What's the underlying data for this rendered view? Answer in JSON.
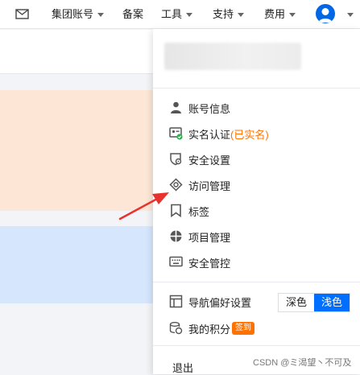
{
  "nav": {
    "group_account": "集团账号",
    "beian": "备案",
    "tools": "工具",
    "support": "支持",
    "billing": "费用"
  },
  "menu": {
    "account_info": "账号信息",
    "realname": "实名认证",
    "realname_status": "(已实名)",
    "security_settings": "安全设置",
    "access_management": "访问管理",
    "tags": "标签",
    "project_management": "项目管理",
    "security_control": "安全管控",
    "nav_preference": "导航偏好设置",
    "theme_dark": "深色",
    "theme_light": "浅色",
    "my_points": "我的积分",
    "sign_in_badge": "签到",
    "logout": "退出"
  },
  "colors": {
    "accent": "#006eff",
    "warning": "#ff7200",
    "annotation": "#e8322e"
  },
  "watermark": "CSDN @ミ渴望丶不可及"
}
